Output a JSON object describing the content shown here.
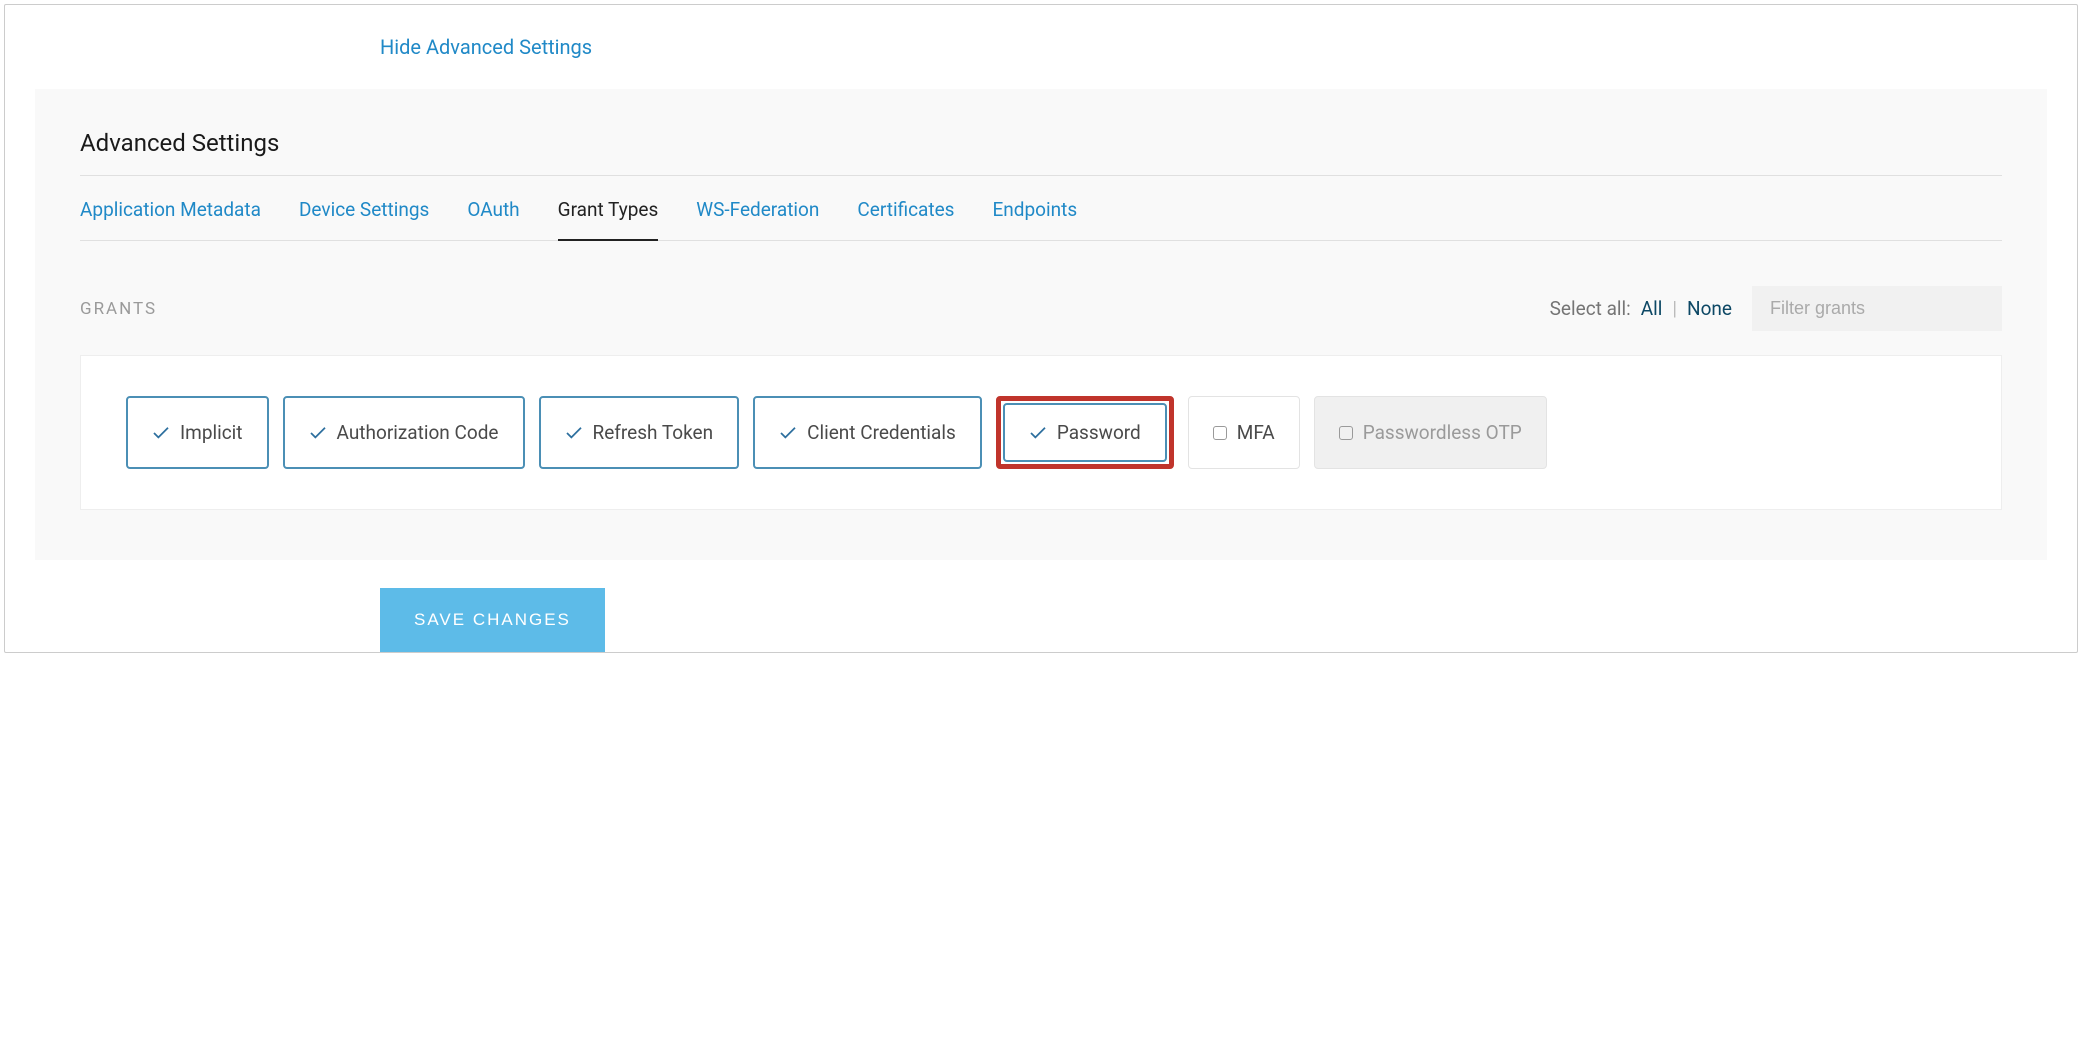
{
  "header": {
    "hide_link": "Hide Advanced Settings"
  },
  "panel": {
    "title": "Advanced Settings"
  },
  "tabs": [
    {
      "label": "Application Metadata",
      "active": false
    },
    {
      "label": "Device Settings",
      "active": false
    },
    {
      "label": "OAuth",
      "active": false
    },
    {
      "label": "Grant Types",
      "active": true
    },
    {
      "label": "WS-Federation",
      "active": false
    },
    {
      "label": "Certificates",
      "active": false
    },
    {
      "label": "Endpoints",
      "active": false
    }
  ],
  "grants": {
    "section_label": "GRANTS",
    "select_all_label": "Select all:",
    "all_label": "All",
    "none_label": "None",
    "filter_placeholder": "Filter grants",
    "items": [
      {
        "label": "Implicit",
        "state": "selected",
        "highlighted": false
      },
      {
        "label": "Authorization Code",
        "state": "selected",
        "highlighted": false
      },
      {
        "label": "Refresh Token",
        "state": "selected",
        "highlighted": false
      },
      {
        "label": "Client Credentials",
        "state": "selected",
        "highlighted": false
      },
      {
        "label": "Password",
        "state": "selected",
        "highlighted": true
      },
      {
        "label": "MFA",
        "state": "unselected",
        "highlighted": false
      },
      {
        "label": "Passwordless OTP",
        "state": "disabled",
        "highlighted": false
      }
    ]
  },
  "actions": {
    "save_label": "SAVE CHANGES"
  }
}
